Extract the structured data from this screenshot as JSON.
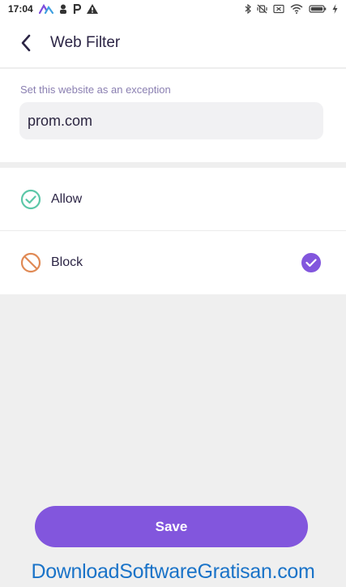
{
  "status_bar": {
    "time": "17:04",
    "left_icons": [
      "app-logo-icon",
      "person-icon",
      "parking-icon",
      "warning-icon"
    ],
    "right_icons": [
      "bluetooth-icon",
      "vibrate-off-icon",
      "sim-off-icon",
      "wifi-icon",
      "battery-icon",
      "charging-icon"
    ]
  },
  "header": {
    "title": "Web Filter",
    "back_icon": "chevron-left-icon"
  },
  "exception": {
    "label": "Set this website as an exception",
    "value": "prom.com"
  },
  "options": [
    {
      "label": "Allow",
      "icon": "check-circle-outline-icon",
      "icon_color": "#5cc7a8",
      "selected": false
    },
    {
      "label": "Block",
      "icon": "block-circle-icon",
      "icon_color": "#e08a55",
      "selected": true
    }
  ],
  "selected_check_color": "#8256dd",
  "save_label": "Save",
  "accent_color": "#8256dd",
  "watermark": "DownloadSoftwareGratisan.com"
}
